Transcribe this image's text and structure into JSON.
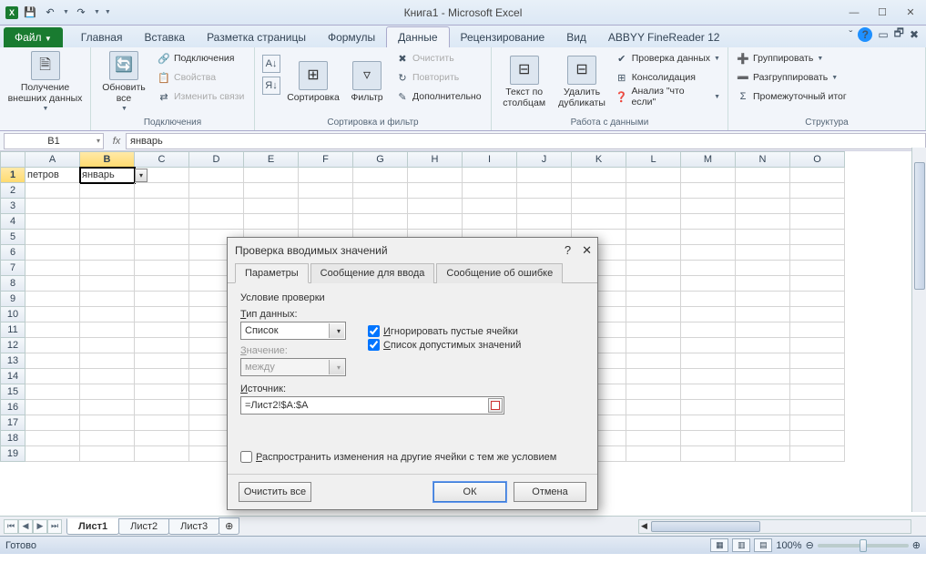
{
  "window": {
    "title": "Книга1 - Microsoft Excel"
  },
  "qat": {
    "save": "💾",
    "undo": "↶",
    "redo": "↷"
  },
  "tabs": {
    "file": "Файл",
    "items": [
      "Главная",
      "Вставка",
      "Разметка страницы",
      "Формулы",
      "Данные",
      "Рецензирование",
      "Вид",
      "ABBYY FineReader 12"
    ],
    "active": "Данные"
  },
  "ribbon": {
    "g1": {
      "label": "",
      "btn": "Получение внешних данных"
    },
    "g2": {
      "label": "Подключения",
      "refresh": "Обновить все",
      "a": "Подключения",
      "b": "Свойства",
      "c": "Изменить связи"
    },
    "g3": {
      "label": "Сортировка и фильтр",
      "sortAZ": "А↓Я",
      "sortZA": "Я↓А",
      "sort": "Сортировка",
      "filter": "Фильтр",
      "clear": "Очистить",
      "reapply": "Повторить",
      "adv": "Дополнительно"
    },
    "g4": {
      "label": "Работа с данными",
      "t2c": "Текст по столбцам",
      "dup": "Удалить дубликаты",
      "dv": "Проверка данных",
      "cons": "Консолидация",
      "whatif": "Анализ \"что если\""
    },
    "g5": {
      "label": "Структура",
      "grp": "Группировать",
      "ungrp": "Разгруппировать",
      "sub": "Промежуточный итог"
    }
  },
  "namebox": "B1",
  "formula": "январь",
  "columns": [
    "A",
    "B",
    "C",
    "D",
    "E",
    "F",
    "G",
    "H",
    "I",
    "J",
    "K",
    "L",
    "M",
    "N",
    "O"
  ],
  "rows": 19,
  "cells": {
    "A1": "петров",
    "B1": "январь"
  },
  "activeCell": "B1",
  "sheets": [
    "Лист1",
    "Лист2",
    "Лист3"
  ],
  "activeSheet": "Лист1",
  "status": {
    "ready": "Готово",
    "zoom": "100%"
  },
  "dialog": {
    "title": "Проверка вводимых значений",
    "tabs": [
      "Параметры",
      "Сообщение для ввода",
      "Сообщение об ошибке"
    ],
    "activeTab": "Параметры",
    "groupTitle": "Условие проверки",
    "typeLabel": "Тип данных:",
    "typeValue": "Список",
    "ignoreBlank": "Игнорировать пустые ячейки",
    "inCell": "Список допустимых значений",
    "valueLabel": "Значение:",
    "valueValue": "между",
    "sourceLabel": "Источник:",
    "sourceValue": "=Лист2!$A:$A",
    "propagate": "Распространить изменения на другие ячейки с тем же условием",
    "clear": "Очистить все",
    "ok": "ОК",
    "cancel": "Отмена"
  }
}
